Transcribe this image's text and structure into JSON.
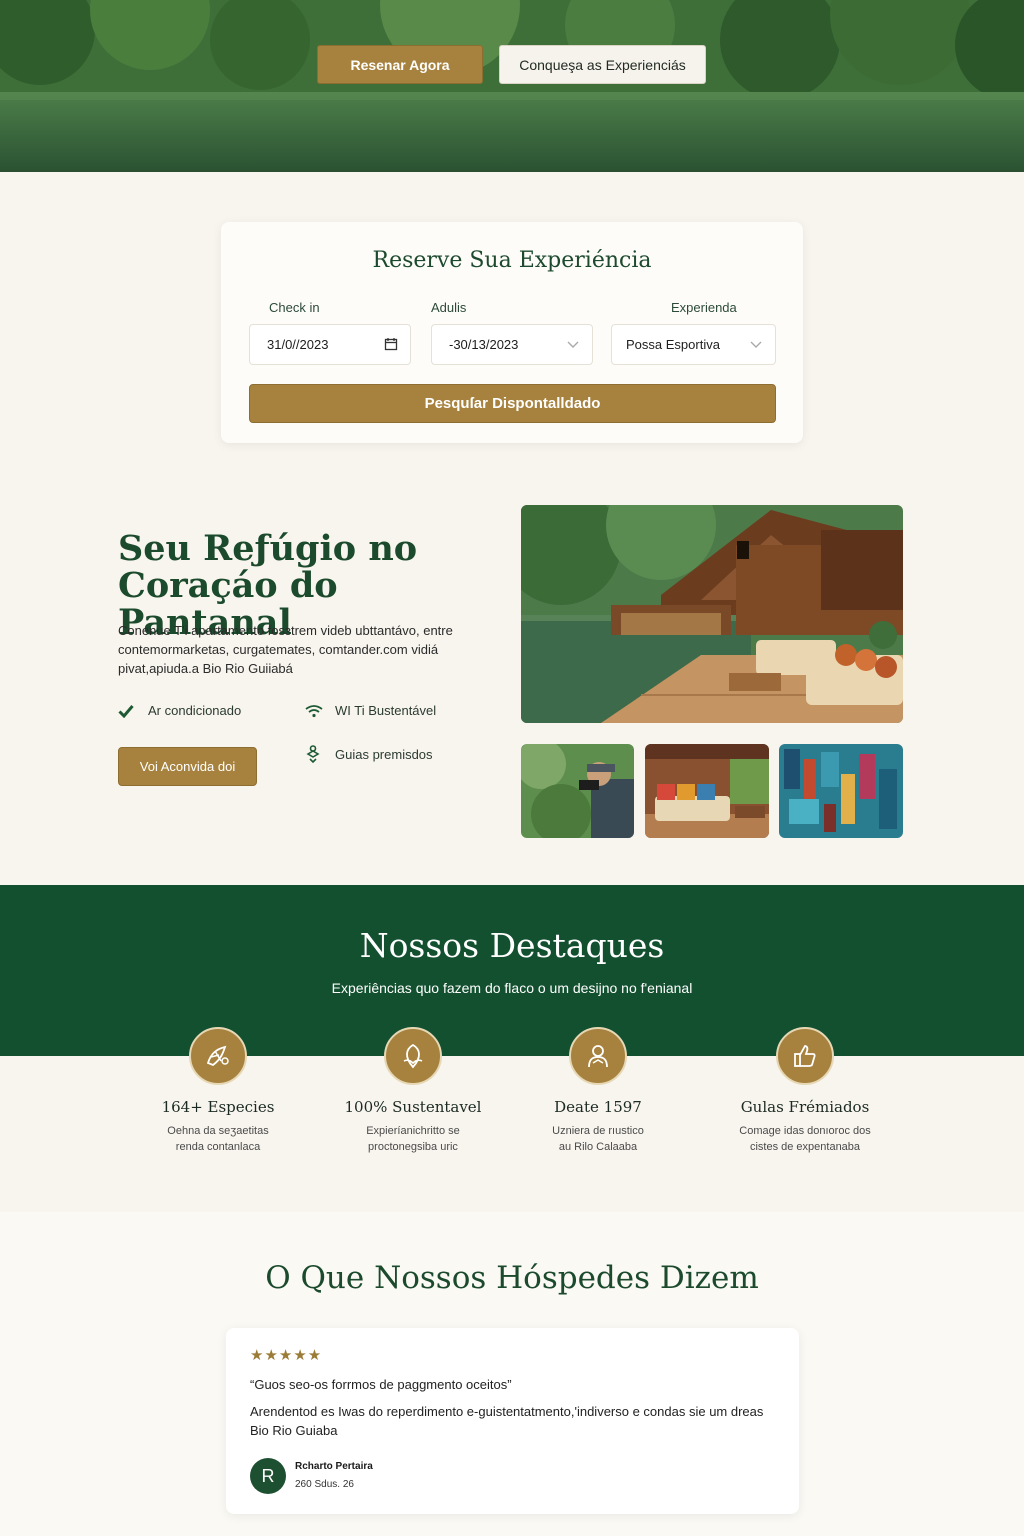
{
  "hero": {
    "book_button": "Resenar Agora",
    "explore_button": "Conqueşa as Experienciás"
  },
  "booking": {
    "title": "Reserve Sua Experiéncia",
    "checkin_label": "Check in",
    "checkin_value": "31/0//2023",
    "adults_label": "Adulis",
    "adults_value": "-30/13/2023",
    "experience_label": "Experienda",
    "experience_value": "Possa Esportiva",
    "submit_label": "Pesquſar Dispontalldado"
  },
  "refuge": {
    "title": "Seu Reƒúgio no Coraçáo do Pantanal",
    "description": "Conenue T'i apartamento fosɜtrem videb ubttantávo, entre contemormarketas, curgatemates, comtander.com vidiá pivat,apiuda.a Bio Rio Guiiabá",
    "features": [
      {
        "label": "Ar condicionado",
        "icon": "check-icon"
      },
      {
        "label": "WI Ti Bustentável",
        "icon": "wifi-icon"
      },
      {
        "label": "Guias premisdos",
        "icon": "guide-icon"
      }
    ],
    "cta": "Voi Aconvida doi"
  },
  "highlights": {
    "title": "Nossos Destaques",
    "subtitle": "Experiências quo fazem do flaco o um desijno no f'enianal",
    "items": [
      {
        "title": "164+ Especies",
        "desc_1": "Oehna da seʒaetitas",
        "desc_2": "renda contanlaca",
        "icon": "wildlife-icon"
      },
      {
        "title": "100% Sustentavel",
        "desc_1": "Expieríanichritto se",
        "desc_2": "proctonegsiba uric",
        "icon": "leaf-hand-icon"
      },
      {
        "title": "Deate 1597",
        "desc_1": "Uzniera de rıustico",
        "desc_2": "au Rilo Calaaba",
        "icon": "person-icon"
      },
      {
        "title": "Gulas Frémiados",
        "desc_1": "Comage idas donıoroc dos",
        "desc_2": "cistes de expentanaba",
        "icon": "thumbs-up-icon"
      }
    ]
  },
  "testimonials": {
    "title": "O Que Nossos Hóspedes Dizem",
    "stars": "★★★★★",
    "quote": "“Guos seo-os forrmos de paggmento oceitos”",
    "review": "Arendentod es Iwas do reperdimento e-guistentatmento,'indiverso e  condas sie um dreas Bio Rio Guiaba",
    "avatar_initial": "R",
    "name": "Rcharto Pertaira",
    "meta": "260 Sdus. 26"
  },
  "colors": {
    "accent_gold": "#a7823e",
    "forest_green": "#12502f",
    "background": "#f8f5ee"
  }
}
